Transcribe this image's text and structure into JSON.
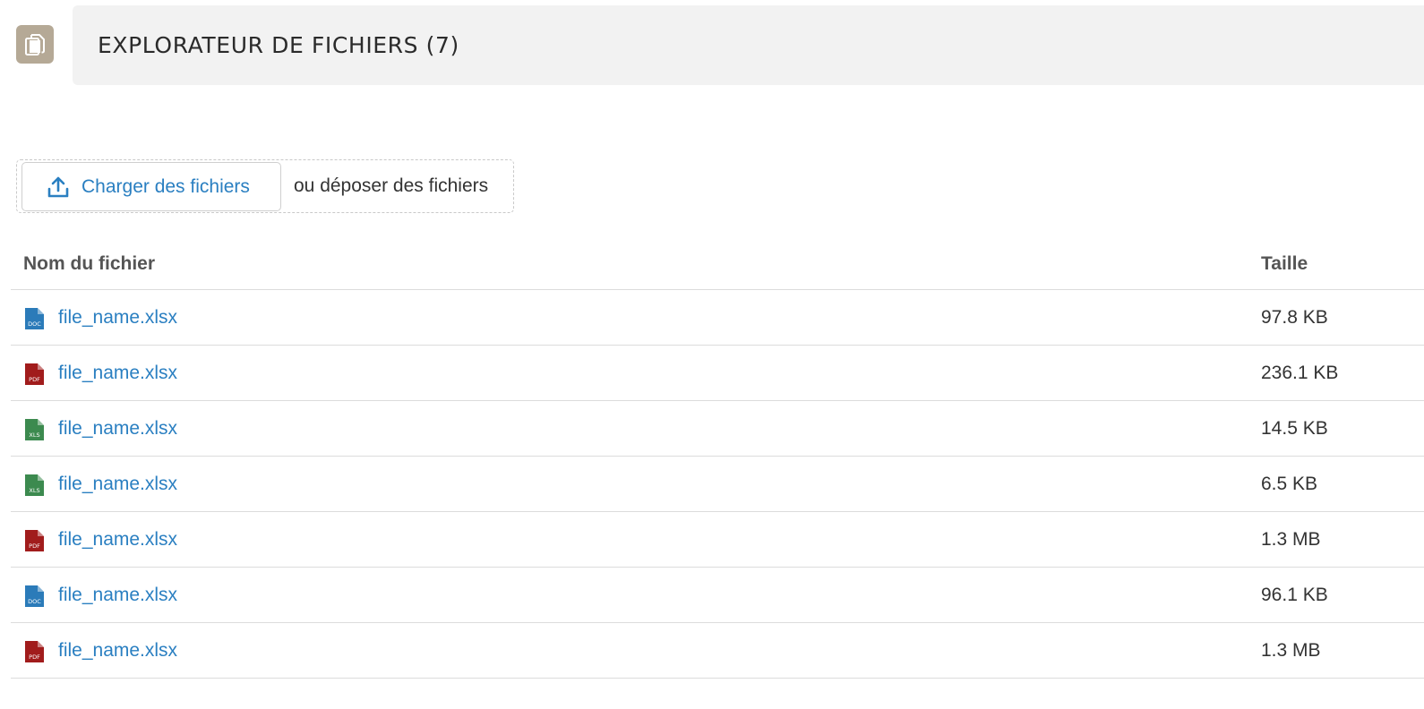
{
  "header": {
    "title": "EXPLORATEUR DE FICHIERS (7)",
    "icon": "documents-icon",
    "icon_color": "#b5a996"
  },
  "upload": {
    "button_label": "Charger des fichiers",
    "button_icon": "upload-icon",
    "drop_text": "ou déposer des fichiers"
  },
  "table": {
    "columns": {
      "name": "Nom du fichier",
      "size": "Taille"
    },
    "rows": [
      {
        "name": "file_name.xlsx",
        "size": "97.8 KB",
        "type": "DOC",
        "icon": "doc-file-icon",
        "color": "#2b7bb9"
      },
      {
        "name": "file_name.xlsx",
        "size": "236.1 KB",
        "type": "PDF",
        "icon": "pdf-file-icon",
        "color": "#a11c1c"
      },
      {
        "name": "file_name.xlsx",
        "size": "14.5 KB",
        "type": "XLS",
        "icon": "xls-file-icon",
        "color": "#3c8a4f"
      },
      {
        "name": "file_name.xlsx",
        "size": "6.5 KB",
        "type": "XLS",
        "icon": "xls-file-icon",
        "color": "#3c8a4f"
      },
      {
        "name": "file_name.xlsx",
        "size": "1.3 MB",
        "type": "PDF",
        "icon": "pdf-file-icon",
        "color": "#a11c1c"
      },
      {
        "name": "file_name.xlsx",
        "size": "96.1 KB",
        "type": "DOC",
        "icon": "doc-file-icon",
        "color": "#2b7bb9"
      },
      {
        "name": "file_name.xlsx",
        "size": "1.3 MB",
        "type": "PDF",
        "icon": "pdf-file-icon",
        "color": "#a11c1c"
      }
    ]
  },
  "colors": {
    "link": "#2a7fc1",
    "header_bg": "#f2f2f2"
  }
}
